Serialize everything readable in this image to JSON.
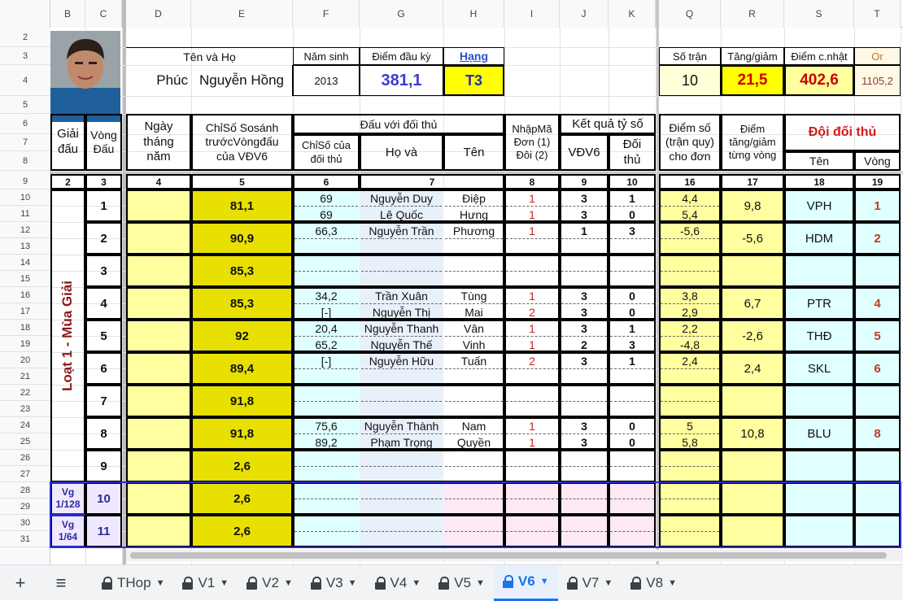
{
  "columns": [
    "B",
    "C",
    "D",
    "E",
    "F",
    "G",
    "H",
    "I",
    "J",
    "K",
    "Q",
    "R",
    "S",
    "T"
  ],
  "row_numbers": [
    "2",
    "3",
    "4",
    "5",
    "6",
    "7",
    "8",
    "9",
    "10",
    "11",
    "12",
    "13",
    "14",
    "15",
    "16",
    "17",
    "18",
    "19",
    "20",
    "21",
    "22",
    "23",
    "24",
    "25",
    "26",
    "27",
    "28",
    "29",
    "30",
    "31"
  ],
  "profile": {
    "name_header": "Tên    và    Họ",
    "first_name": "Phúc",
    "last_name": "Nguyễn Hồng",
    "birth_year_label": "Năm sinh",
    "birth_year": "2013",
    "start_score_label": "Điểm đầu kỳ",
    "start_score": "381,1",
    "rank_label": "Hạng",
    "rank": "T3"
  },
  "summary": {
    "matches_label": "Số trận",
    "matches": "10",
    "change_label": "Tăng/giảm",
    "change": "21,5",
    "updated_label": "Điểm c.nhật",
    "updated": "402,6",
    "or_label": "Or",
    "or_value": "1105,2"
  },
  "headers": {
    "b": "Giải\nđấu",
    "c": "Vòng\nĐấu",
    "d": "Ngày\ntháng\nnăm",
    "e": "ChỉSố Sosánh\ntrướcVòngđấu\ncủa VĐV6",
    "opp_group": "Đấu với đối thủ",
    "f": "ChỉSố của\nđối thủ",
    "g": "Họ     và",
    "h": "Tên",
    "i": "NhậpMã\nĐơn (1)\nĐôi (2)",
    "result_group": "Kết quả tỷ số",
    "j": "VĐV6",
    "k": "Đối\nthủ",
    "q": "Điểm số\n(trận quy)\ncho đơn",
    "r": "Điểm\ntăng/giảm\ntừng vòng",
    "team_group": "Đội đối thủ",
    "s": "Tên",
    "t": "Vòng"
  },
  "col_numbers": {
    "b": "2",
    "c": "3",
    "d": "4",
    "e": "5",
    "f": "6",
    "g": "7",
    "i": "8",
    "j": "9",
    "k": "10",
    "q": "16",
    "r": "17",
    "s": "18",
    "t": "19"
  },
  "season_label": "Loạt 1 - Mùa Giải",
  "rounds": [
    {
      "round": "1",
      "compare": "81,1",
      "opps": [
        {
          "idx": "69",
          "ho": "Nguyễn Duy",
          "ten": "Điệp",
          "code": "1",
          "me": "3",
          "them": "1",
          "pts": "4,4"
        },
        {
          "idx": "69",
          "ho": "Lê Quốc",
          "ten": "Hưng",
          "code": "1",
          "me": "3",
          "them": "0",
          "pts": "5,4"
        }
      ],
      "change": "9,8",
      "team": "VPH",
      "team_round": "1"
    },
    {
      "round": "2",
      "compare": "90,9",
      "opps": [
        {
          "idx": "66,3",
          "ho": "Nguyễn Trần",
          "ten": "Phương",
          "code": "1",
          "me": "1",
          "them": "3",
          "pts": "-5,6"
        }
      ],
      "change": "-5,6",
      "team": "HDM",
      "team_round": "2"
    },
    {
      "round": "3",
      "compare": "85,3",
      "opps": [],
      "change": "",
      "team": "",
      "team_round": ""
    },
    {
      "round": "4",
      "compare": "85,3",
      "opps": [
        {
          "idx": "34,2",
          "ho": "Trần Xuân",
          "ten": "Tùng",
          "code": "1",
          "me": "3",
          "them": "0",
          "pts": "3,8"
        },
        {
          "idx": "[-]",
          "ho": "Nguyễn Thị",
          "ten": "Mai",
          "code": "2",
          "me": "3",
          "them": "0",
          "pts": "2,9"
        }
      ],
      "change": "6,7",
      "team": "PTR",
      "team_round": "4"
    },
    {
      "round": "5",
      "compare": "92",
      "opps": [
        {
          "idx": "20,4",
          "ho": "Nguyễn Thanh",
          "ten": "Vân",
          "code": "1",
          "me": "3",
          "them": "1",
          "pts": "2,2"
        },
        {
          "idx": "65,2",
          "ho": "Nguyễn Thế",
          "ten": "Vinh",
          "code": "1",
          "me": "2",
          "them": "3",
          "pts": "-4,8"
        }
      ],
      "change": "-2,6",
      "team": "THĐ",
      "team_round": "5"
    },
    {
      "round": "6",
      "compare": "89,4",
      "opps": [
        {
          "idx": "[-]",
          "ho": "Nguyễn Hữu",
          "ten": "Tuấn",
          "code": "2",
          "me": "3",
          "them": "1",
          "pts": "2,4"
        }
      ],
      "change": "2,4",
      "team": "SKL",
      "team_round": "6"
    },
    {
      "round": "7",
      "compare": "91,8",
      "opps": [],
      "change": "",
      "team": "",
      "team_round": ""
    },
    {
      "round": "8",
      "compare": "91,8",
      "opps": [
        {
          "idx": "75,6",
          "ho": "Nguyễn Thành",
          "ten": "Nam",
          "code": "1",
          "me": "3",
          "them": "0",
          "pts": "5"
        },
        {
          "idx": "89,2",
          "ho": "Phạm Trọng",
          "ten": "Quyền",
          "code": "1",
          "me": "3",
          "them": "0",
          "pts": "5,8"
        }
      ],
      "change": "10,8",
      "team": "BLU",
      "team_round": "8"
    },
    {
      "round": "9",
      "compare": "2,6",
      "opps": [],
      "change": "",
      "team": "",
      "team_round": ""
    },
    {
      "round": "10",
      "compare": "2,6",
      "opps": [],
      "change": "",
      "team": "",
      "team_round": "",
      "stage": "Vg\n1/128"
    },
    {
      "round": "11",
      "compare": "2,6",
      "opps": [],
      "change": "",
      "team": "",
      "team_round": "",
      "stage": "Vg\n1/64"
    }
  ],
  "tabs": {
    "add": "+",
    "menu": "≡",
    "items": [
      "THop",
      "V1",
      "V2",
      "V3",
      "V4",
      "V5",
      "V6",
      "V7",
      "V8"
    ],
    "active": "V6"
  },
  "colors": {
    "yellow": "#ffff9f",
    "olive_yellow": "#e8e000",
    "cyan": "#e0ffff",
    "light_blue": "#e8f0fa",
    "pink": "#fde9f6",
    "red": "#cc0000",
    "blue": "#3333cc",
    "dark_red": "#8b1a1a"
  }
}
